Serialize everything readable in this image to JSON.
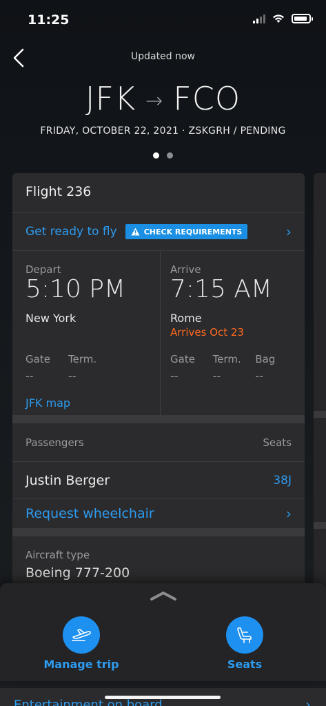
{
  "status_bar": {
    "time": "11:25"
  },
  "header": {
    "updated": "Updated now",
    "origin": "JFK",
    "destination": "FCO",
    "subtitle": "FRIDAY, OCTOBER 22, 2021 · ZSKGRH / PENDING"
  },
  "pager": {
    "pages": 2,
    "current": 1
  },
  "flight": {
    "title": "Flight 236",
    "ready_text": "Get ready to fly",
    "check_label": "CHECK REQUIREMENTS",
    "depart": {
      "label": "Depart",
      "time": "5:10 PM",
      "city": "New York",
      "gate_label": "Gate",
      "gate": "--",
      "term_label": "Term.",
      "term": "--",
      "map_link": "JFK map"
    },
    "arrive": {
      "label": "Arrive",
      "time": "7:15 AM",
      "city": "Rome",
      "note": "Arrives Oct 23",
      "gate_label": "Gate",
      "gate": "--",
      "term_label": "Term.",
      "term": "--",
      "bag_label": "Bag",
      "bag": "--"
    }
  },
  "passengers": {
    "header": "Passengers",
    "seats_header": "Seats",
    "list": [
      {
        "name": "Justin Berger",
        "seat": "38J"
      }
    ],
    "wheelchair": "Request wheelchair"
  },
  "aircraft": {
    "label": "Aircraft type",
    "value": "Boeing 777-200"
  },
  "actions": {
    "manage_trip": "Manage trip",
    "seats": "Seats"
  },
  "below": {
    "entertainment": "Entertainment on board"
  },
  "colors": {
    "accent": "#2d9cf0",
    "warning": "#ff6a1f",
    "button_fill": "#1e90f0"
  }
}
